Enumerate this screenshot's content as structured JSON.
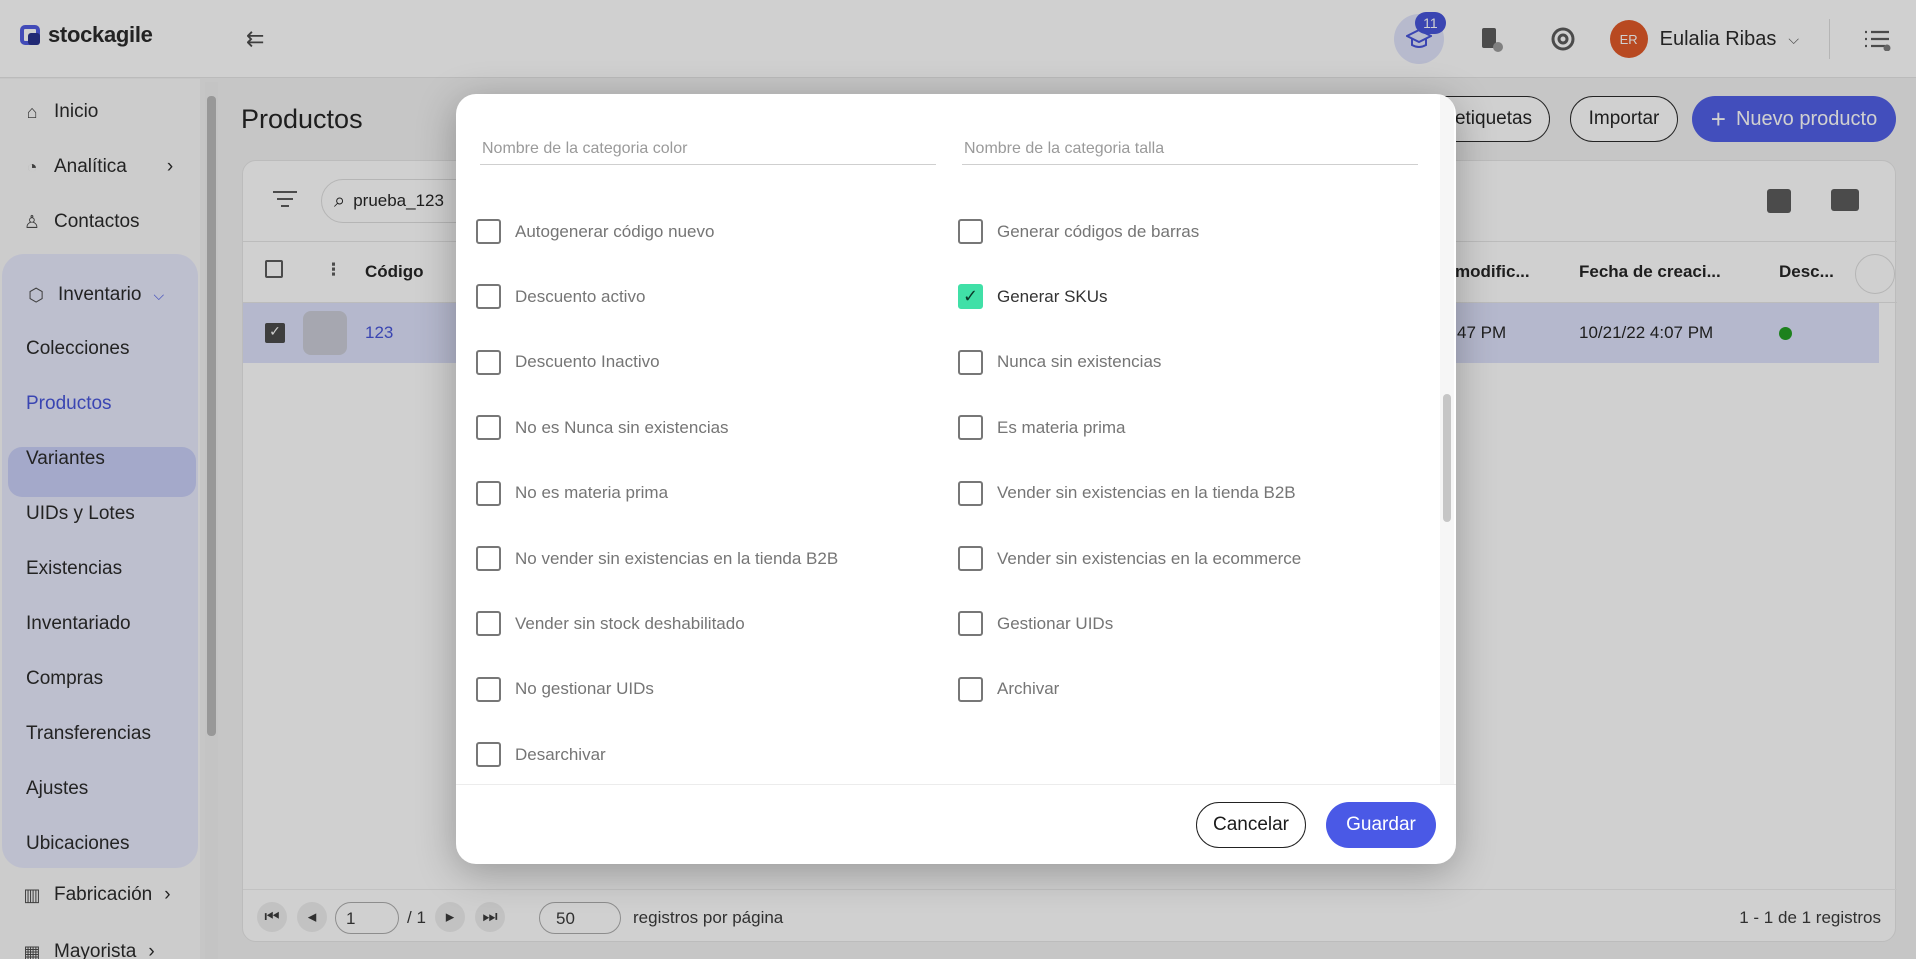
{
  "app": {
    "name": "stockagile"
  },
  "header": {
    "notifications_count": "11",
    "user_initials": "ER",
    "user_name": "Eulalia Ribas"
  },
  "sidebar": {
    "top_items": [
      {
        "label": "Inicio",
        "icon": "home-icon"
      },
      {
        "label": "Analítica",
        "icon": "chart-icon"
      },
      {
        "label": "Contactos",
        "icon": "person-icon"
      }
    ],
    "inventory": {
      "label": "Inventario",
      "items": [
        "Colecciones",
        "Productos",
        "Variantes",
        "UIDs y Lotes",
        "Existencias",
        "Inventariado",
        "Compras",
        "Transferencias",
        "Ajustes",
        "Ubicaciones"
      ],
      "active": "Productos"
    },
    "bottom_items": [
      {
        "label": "Fabricación"
      },
      {
        "label": "Mayorista"
      }
    ]
  },
  "page": {
    "title": "Productos",
    "labels_button": "etiquetas",
    "import_button": "Importar",
    "new_product_button": "Nuevo producto",
    "search_value": "prueba_123"
  },
  "table": {
    "headers": [
      "Código",
      "modific...",
      "Fecha de creaci...",
      "Desc..."
    ],
    "rows": [
      {
        "code": "123",
        "modified": "47 PM",
        "created": "10/21/22 4:07 PM"
      }
    ]
  },
  "pagination": {
    "page_value": "1",
    "total_pages": "/ 1",
    "page_size": "50",
    "page_size_label": "registros por página",
    "summary": "1 - 1 de 1 registros"
  },
  "modal": {
    "color_placeholder": "Nombre de la categoria color",
    "size_placeholder": "Nombre de la categoria talla",
    "left_options": [
      {
        "label": "Autogenerar código nuevo",
        "checked": false
      },
      {
        "label": "Descuento activo",
        "checked": false
      },
      {
        "label": "Descuento Inactivo",
        "checked": false
      },
      {
        "label": "No es Nunca sin existencias",
        "checked": false
      },
      {
        "label": "No es materia prima",
        "checked": false
      },
      {
        "label": "No vender sin existencias en la tienda B2B",
        "checked": false
      },
      {
        "label": "Vender sin stock deshabilitado",
        "checked": false
      },
      {
        "label": "No gestionar UIDs",
        "checked": false
      },
      {
        "label": "Desarchivar",
        "checked": false
      }
    ],
    "right_options": [
      {
        "label": "Generar códigos de barras",
        "checked": false
      },
      {
        "label": "Generar SKUs",
        "checked": true
      },
      {
        "label": "Nunca sin existencias",
        "checked": false
      },
      {
        "label": "Es materia prima",
        "checked": false
      },
      {
        "label": "Vender sin existencias en la tienda B2B",
        "checked": false
      },
      {
        "label": "Vender sin existencias en la ecommerce",
        "checked": false
      },
      {
        "label": "Gestionar UIDs",
        "checked": false
      },
      {
        "label": "Archivar",
        "checked": false
      }
    ],
    "cancel_button": "Cancelar",
    "save_button": "Guardar"
  }
}
